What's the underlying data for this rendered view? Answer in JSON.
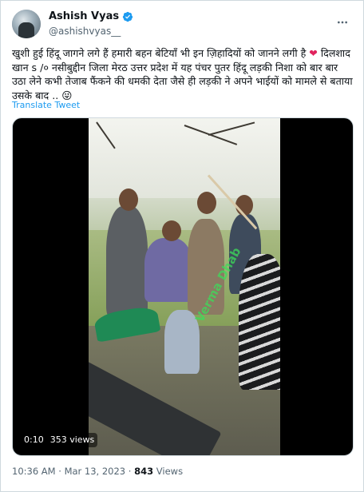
{
  "author": {
    "name": "Ashish Vyas",
    "handle": "@ashishvyas__",
    "verified": true,
    "avatar_icon": "avatar-photo"
  },
  "more_icon": "more-icon",
  "tweet": {
    "text_line1": "खुशी हुई हिंदू जागने लगे हैं हमारी बहन बेटियाँ भी इन ज़िहादियों को जानने लगी है",
    "text_rest": "दिलशाद खान s /० नसीबुद्दीन जिला मेरठ उत्तर प्रदेश में यह पंचर पुतर हिंदू लड़की निशा को  बार बार उठा लेने  कभी तेजाब फैंकने की धमकी देता जैसे ही लड़की ने अपने भाईयों को मामले से बताया उसके बाद ..",
    "heart_emoji": "❤",
    "face_emoji": "😜",
    "translate_label": "Translate Tweet"
  },
  "video": {
    "time": "0:10",
    "views_label": "353 views",
    "watermark": "Verma Dhab"
  },
  "meta": {
    "time": "10:36 AM",
    "separator": "·",
    "date": "Mar 13, 2023",
    "views_count": "843",
    "views_label": "Views"
  },
  "colors": {
    "accent": "#1d9bf0",
    "text_primary": "#0f1419",
    "text_secondary": "#536471",
    "heart": "#e0245e"
  }
}
